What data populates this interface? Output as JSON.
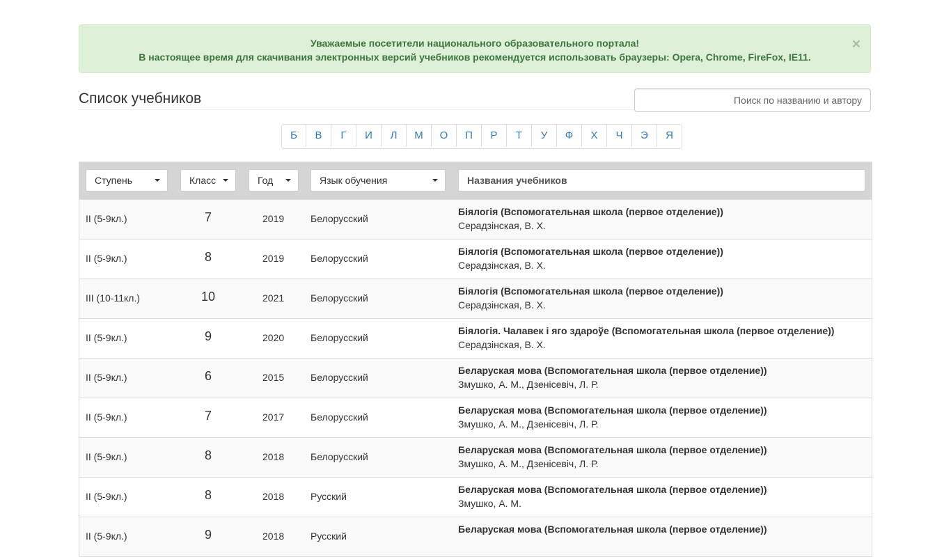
{
  "alert": {
    "line1": "Уважаемые посетители национального образовательного портала!",
    "line2": "В настоящее время для скачивания электронных версий учебников рекомендуется использовать браузеры: Opera, Chrome, FireFox, IE11.",
    "close": "×"
  },
  "page_title": "Список учебников",
  "search": {
    "placeholder": "Поиск по названию и автору",
    "value": ""
  },
  "alphabet": [
    "Б",
    "В",
    "Г",
    "И",
    "Л",
    "М",
    "О",
    "П",
    "Р",
    "Т",
    "У",
    "Ф",
    "Х",
    "Ч",
    "Э",
    "Я"
  ],
  "filters": {
    "stage": "Ступень",
    "class": "Класс",
    "year": "Год",
    "language": "Язык обучения",
    "titles": "Названия учебников"
  },
  "rows": [
    {
      "stage": "II (5-9кл.)",
      "grade": "7",
      "year": "2019",
      "lang": "Белорусский",
      "title": "Біялогія (Вспомогательная школа (первое отделение))",
      "author": "Серадзінская, В. Х."
    },
    {
      "stage": "II (5-9кл.)",
      "grade": "8",
      "year": "2019",
      "lang": "Белорусский",
      "title": "Біялогія (Вспомогательная школа (первое отделение))",
      "author": "Серадзінская, В. Х."
    },
    {
      "stage": "III (10-11кл.)",
      "grade": "10",
      "year": "2021",
      "lang": "Белорусский",
      "title": "Біялогія (Вспомогательная школа (первое отделение))",
      "author": "Серадзінская, В. Х."
    },
    {
      "stage": "II (5-9кл.)",
      "grade": "9",
      "year": "2020",
      "lang": "Белорусский",
      "title": "Біялогія. Чалавек і яго здароўе (Вспомогательная школа (первое отделение))",
      "author": "Серадзінская, В. Х."
    },
    {
      "stage": "II (5-9кл.)",
      "grade": "6",
      "year": "2015",
      "lang": "Белорусский",
      "title": "Беларуская мова (Вспомогательная школа (первое отделение))",
      "author": "Змушко, А. М., Дзенісевіч, Л. Р."
    },
    {
      "stage": "II (5-9кл.)",
      "grade": "7",
      "year": "2017",
      "lang": "Белорусский",
      "title": "Беларуская мова (Вспомогательная школа (первое отделение))",
      "author": "Змушко, А. М., Дзенісевіч, Л. Р."
    },
    {
      "stage": "II (5-9кл.)",
      "grade": "8",
      "year": "2018",
      "lang": "Белорусский",
      "title": "Беларуская мова (Вспомогательная школа (первое отделение))",
      "author": "Змушко, А. М., Дзенісевіч, Л. Р."
    },
    {
      "stage": "II (5-9кл.)",
      "grade": "8",
      "year": "2018",
      "lang": "Русский",
      "title": "Беларуская мова (Вспомогательная школа (первое отделение))",
      "author": "Змушко, А. М."
    },
    {
      "stage": "II (5-9кл.)",
      "grade": "9",
      "year": "2018",
      "lang": "Русский",
      "title": "Беларуская мова (Вспомогательная школа (первое отделение))",
      "author": ""
    }
  ]
}
